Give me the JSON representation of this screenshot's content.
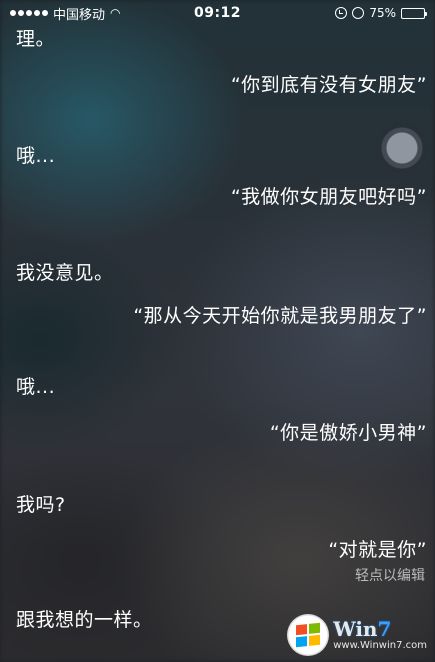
{
  "status_bar": {
    "carrier": "中国移动",
    "time": "09:12",
    "battery_percent": "75%",
    "battery_level": 0.75
  },
  "conversation": [
    {
      "side": "assistant",
      "text": "理。"
    },
    {
      "side": "user",
      "text": "“你到底有没有女朋友”"
    },
    {
      "side": "assistant",
      "text": "哦..."
    },
    {
      "side": "user",
      "text": "“我做你女朋友吧好吗”"
    },
    {
      "side": "assistant",
      "text": "我没意见。"
    },
    {
      "side": "user",
      "text": "“那从今天开始你就是我男朋友了”"
    },
    {
      "side": "assistant",
      "text": "哦..."
    },
    {
      "side": "user",
      "text": "“你是傲娇小男神”"
    },
    {
      "side": "assistant",
      "text": "我吗?"
    },
    {
      "side": "user",
      "text": "“对就是你”"
    },
    {
      "side": "assistant",
      "text": "跟我想的一样。"
    }
  ],
  "edit_hint": "轻点以编辑",
  "watermark": {
    "brand_prefix": "Win",
    "brand_suffix": "7",
    "url": "www.Winwin7.com",
    "colors": [
      "#f25022",
      "#7fba00",
      "#00a4ef",
      "#ffb900"
    ]
  },
  "icons": [
    "signal-dots-icon",
    "wifi-icon",
    "rotation-lock-icon",
    "alarm-icon",
    "battery-icon",
    "siri-mic-icon",
    "windows-logo-icon"
  ]
}
